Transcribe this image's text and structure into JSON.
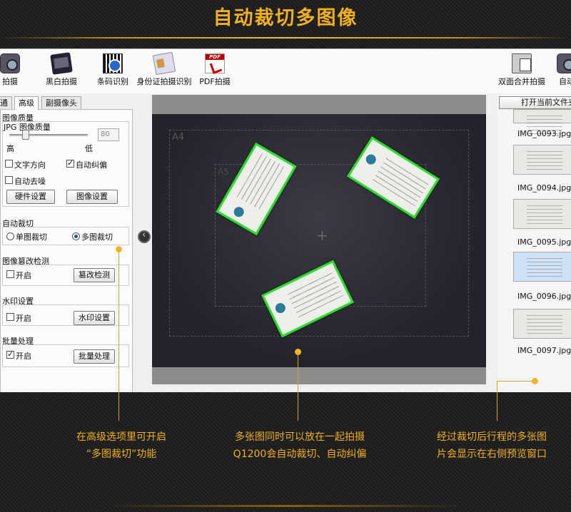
{
  "header": {
    "title": "自动裁切多图像"
  },
  "toolbar": {
    "items": [
      {
        "label": "拍摄",
        "icon": "camera-icon"
      },
      {
        "label": "黑白拍摄",
        "icon": "photo-icon"
      },
      {
        "label": "条码识别",
        "icon": "barcode-icon"
      },
      {
        "label": "身份证拍摄识别",
        "icon": "id-card-icon"
      },
      {
        "label": "PDF拍摄",
        "icon": "pdf-icon"
      },
      {
        "label": "双面合并拍摄",
        "icon": "duplex-icon"
      },
      {
        "label": "自动",
        "icon": "auto-icon"
      }
    ]
  },
  "tabs": [
    "通",
    "高级",
    "副摄像头"
  ],
  "panel": {
    "image_quality": {
      "heading": "图像质量",
      "jpg_label": "JPG 图像质量",
      "high": "高",
      "low": "低",
      "value": "80"
    },
    "text_direction": "文字方向",
    "auto_deskew": "自动纠偏",
    "auto_denoise": "自动去噪",
    "hardware_settings": "硬件设置",
    "image_settings": "图像设置",
    "auto_crop": {
      "heading": "自动裁切",
      "single": "单图裁切",
      "multi": "多图裁切"
    },
    "tamper": {
      "heading": "图像篡改检测",
      "enable": "开启",
      "button": "篡改检测"
    },
    "watermark": {
      "heading": "水印设置",
      "enable": "开启",
      "button": "水印设置"
    },
    "batch": {
      "heading": "批量处理",
      "enable": "开启",
      "button": "批量处理"
    }
  },
  "preview": {
    "a4": "A4",
    "a5": "A5",
    "crosshair": "+"
  },
  "right_panel": {
    "open_button": "打开当前文件夹",
    "files": [
      "IMG_0093.jpg",
      "IMG_0094.jpg",
      "IMG_0095.jpg",
      "IMG_0096.jpg",
      "IMG_0097.jpg"
    ]
  },
  "captions": {
    "left": [
      "在高级选项里可开启",
      "“多图裁切”功能"
    ],
    "center": [
      "多张图同时可以放在一起拍摄",
      "Q1200会自动裁切、自动纠偏"
    ],
    "right": [
      "经过裁切后行程的多张图",
      "片会显示在右侧预览窗口"
    ]
  },
  "colors": {
    "accent": "#f0b020",
    "crop_border": "#26e02a"
  }
}
